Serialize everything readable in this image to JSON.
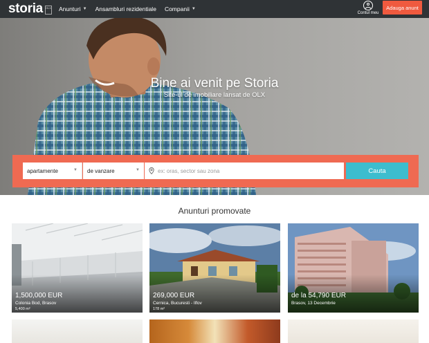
{
  "nav": {
    "logo": "storia",
    "logo_badge": "OLX",
    "menu": [
      {
        "label": "Anunturi",
        "dropdown": true
      },
      {
        "label": "Ansambluri rezidentiale",
        "dropdown": false
      },
      {
        "label": "Companii",
        "dropdown": true
      }
    ],
    "account_label": "Contul meu",
    "add_button": "Adauga anunt"
  },
  "hero": {
    "title": "Bine ai venit pe Storia",
    "subtitle": "Site-ul de imobiliare lansat de OLX"
  },
  "search": {
    "property_type": "apartamente",
    "transaction": "de vanzare",
    "location_placeholder": "ex: oras, sector sau zona",
    "location_value": "",
    "submit": "Cauta"
  },
  "listings": {
    "title": "Anunturi promovate",
    "items": [
      {
        "price": "1,500,000 EUR",
        "location": "Colonia Bod, Brasov",
        "area": "5,400 m²"
      },
      {
        "price": "269,000 EUR",
        "location": "Cernica, Bucuresti - Ilfov",
        "area": "178 m²"
      },
      {
        "price": "de la 54,790 EUR",
        "location": "Brasov, 13 Decembrie",
        "area": ""
      }
    ]
  },
  "colors": {
    "nav_bg": "#2f3336",
    "accent_orange": "#ef5a3f",
    "search_band": "#ef6a52",
    "search_button": "#3dbdce"
  }
}
